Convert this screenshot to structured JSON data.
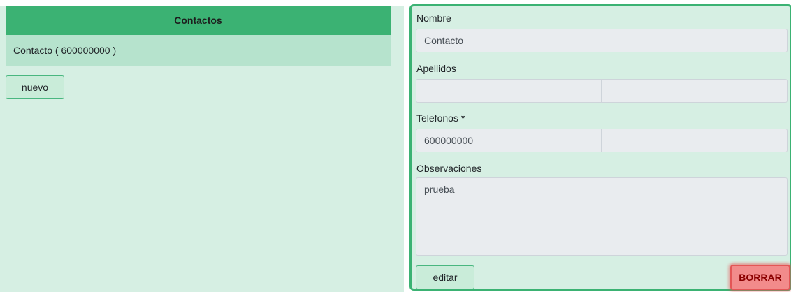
{
  "contacts_panel": {
    "header": "Contactos",
    "items": [
      {
        "label": "Contacto ( 600000000 )"
      }
    ],
    "new_button": "nuevo"
  },
  "detail_panel": {
    "nombre": {
      "label": "Nombre",
      "value": "Contacto"
    },
    "apellidos": {
      "label": "Apellidos",
      "value_1": "",
      "value_2": ""
    },
    "telefonos": {
      "label": "Telefonos *",
      "value_1": "600000000",
      "value_2": ""
    },
    "observaciones": {
      "label": "Observaciones",
      "value": "prueba"
    },
    "edit_button": "editar",
    "delete_button": "BORRAR"
  },
  "colors": {
    "accent": "#3bb273",
    "panel_background": "#d6efe3",
    "selected_item": "#b6e3cd",
    "danger": "#f28b8b"
  }
}
